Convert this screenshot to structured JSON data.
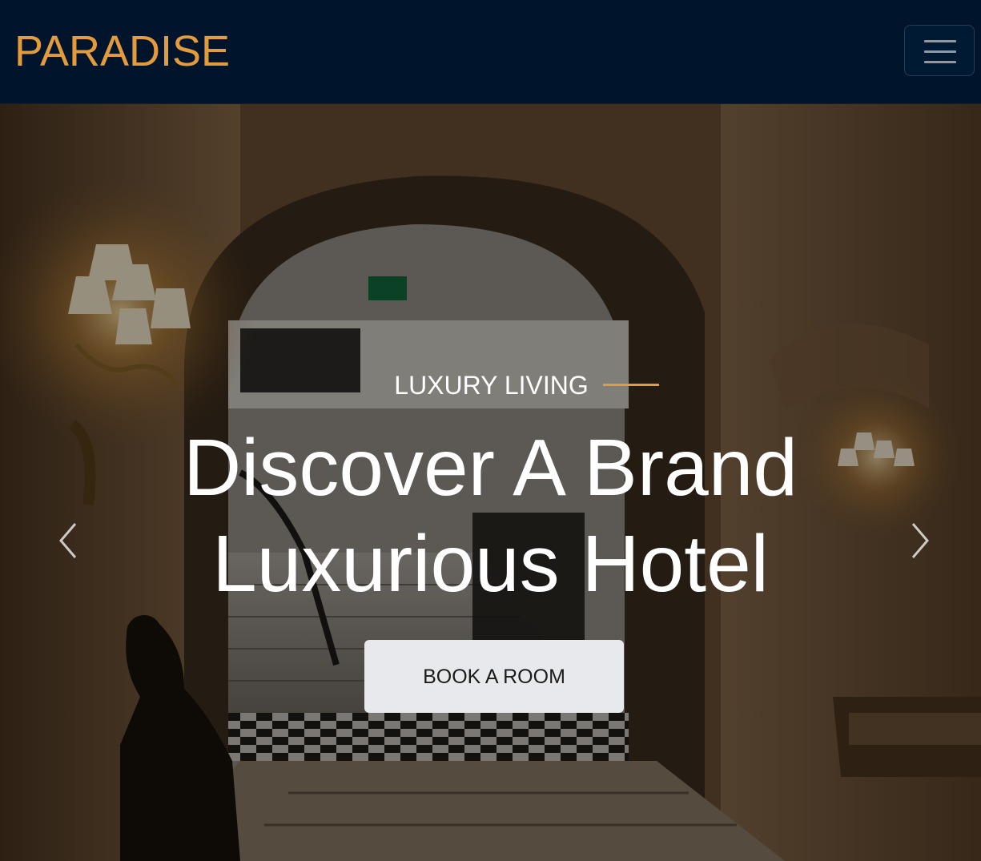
{
  "navbar": {
    "brand": "PARADISE",
    "toggler_icon": "hamburger-menu-icon"
  },
  "hero": {
    "eyebrow": "LUXURY LIVING",
    "headline_line1": "Discover A Brand",
    "headline_line2": "Luxurious Hotel",
    "cta_label": "BOOK A ROOM",
    "prev_icon": "chevron-left-icon",
    "next_icon": "chevron-right-icon"
  },
  "colors": {
    "nav_bg": "#00152b",
    "brand_accent": "#e39b3c",
    "button_bg": "#e8e9ec"
  }
}
